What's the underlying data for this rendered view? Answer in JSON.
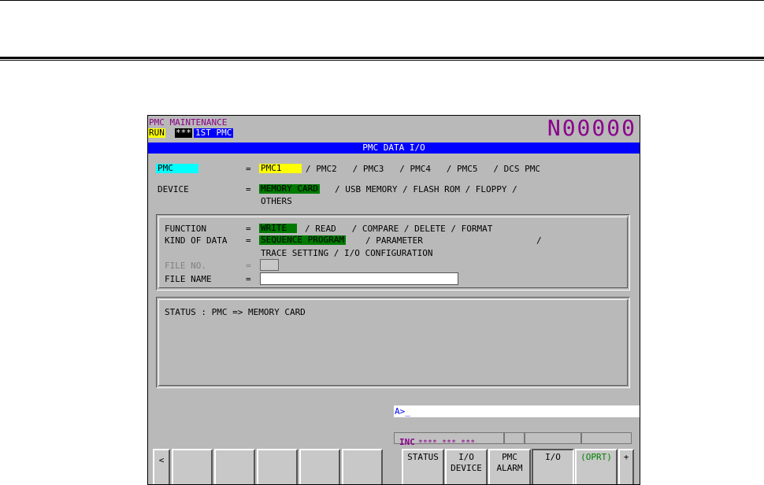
{
  "header": {
    "screen_title": "PMC MAINTENANCE",
    "run": "RUN",
    "stars": "***",
    "pmc_path": "1ST PMC",
    "onumber": "N00000"
  },
  "title_bar": "PMC DATA I/O",
  "rows": {
    "pmc": {
      "label": "PMC",
      "eq": "=",
      "selected": "PMC1",
      "options": "/ PMC2   / PMC3   / PMC4   / PMC5   / DCS PMC"
    },
    "device": {
      "label": "DEVICE",
      "eq": "=",
      "selected": "MEMORY CARD",
      "options": "/ USB MEMORY / FLASH ROM / FLOPPY /",
      "options2": "OTHERS"
    },
    "function": {
      "label": "FUNCTION",
      "eq": "=",
      "selected": "WRITE",
      "options": "/ READ   / COMPARE / DELETE / FORMAT"
    },
    "kind": {
      "label": "KIND OF DATA",
      "eq": "=",
      "selected": "SEQUENCE PROGRAM",
      "options": "/ PARAMETER",
      "slash": "/",
      "options2": "TRACE SETTING / I/O CONFIGURATION"
    },
    "file_no": {
      "label": "FILE NO.",
      "eq": "=",
      "value": ""
    },
    "file_name": {
      "label": "FILE NAME",
      "eq": "=",
      "value": ""
    }
  },
  "status_text": "STATUS : PMC => MEMORY CARD",
  "key_input": "A>_",
  "status_bar": {
    "mode": "INC",
    "info": "**** *** ***"
  },
  "softkeys": {
    "left_arrow": "<",
    "right_arrow": "+",
    "status": "STATUS",
    "io_device_1": "I/O",
    "io_device_2": "DEVICE",
    "pmc_alarm_1": "PMC",
    "pmc_alarm_2": "ALARM",
    "io": "I/O",
    "oprt": "(OPRT)"
  },
  "colors": {
    "magenta": "#8b008b",
    "blue": "#0000ff",
    "yellow": "#ffff00",
    "cyan": "#00ffff",
    "green": "#007a00"
  }
}
